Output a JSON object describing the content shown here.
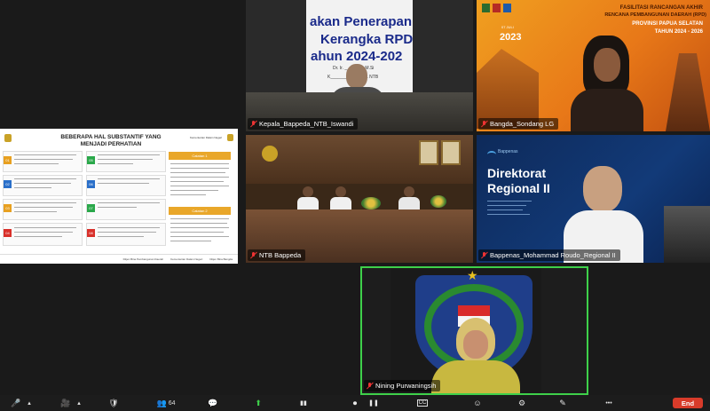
{
  "tiles": {
    "top_center": {
      "name": "Kepala_Bappeda_NTB_Iswandi",
      "slide_lines": [
        "akan Penerapan",
        "Kerangka RPD",
        "ahun 2024-202"
      ],
      "caption_lines": [
        "Dr. Ir. ___ANDI, M.Si",
        "K______________v. NTB"
      ]
    },
    "top_right": {
      "name": "Bangda_Sondang LG",
      "banner_line1": "FASILITASI RANCANGAN AKHIR",
      "banner_line2": "RENCANA PEMBANGUNAN DAERAH (RPD)",
      "banner_line3": "PROVINSI PAPUA SELATAN",
      "banner_line4": "TAHUN 2024 - 2026",
      "year": "2023",
      "date": "07 JULI"
    },
    "middle_center": {
      "name": "NTB Bappeda"
    },
    "middle_right": {
      "name": "Bappenas_Mohammad Roudo_Regional II",
      "title_line1": "Direktorat",
      "title_line2": "Regional II",
      "logo_text": "Bappenas"
    },
    "bottom_center": {
      "name": "Nining Purwaningsih"
    }
  },
  "slide": {
    "title_line1": "BEBERAPA HAL SUBSTANTIF YANG",
    "title_line2": "MENJADI PERHATIAN",
    "org": "Kementerian Dalam Negeri",
    "caption1": "Catatan 1",
    "caption2": "Catatan 2",
    "footer1": "Ditjen Bina Pembangunan Daerah",
    "footer2": "Kementerian Dalam Negeri",
    "footer3": "Ditjen Bina Bangda",
    "items": [
      "01",
      "02",
      "03",
      "04",
      "05",
      "06",
      "07",
      "08"
    ]
  },
  "toolbar": {
    "items": [
      {
        "glyph": "🎤",
        "name": "audio-icon"
      },
      {
        "glyph": "▴",
        "name": "audio-options-icon"
      },
      {
        "glyph": "🎥",
        "name": "video-icon"
      },
      {
        "glyph": "▴",
        "name": "video-options-icon"
      },
      {
        "glyph": "🛡",
        "name": "security-icon"
      },
      {
        "glyph": "👥",
        "name": "participants-icon",
        "count": "64"
      },
      {
        "glyph": "💬",
        "name": "chat-icon"
      },
      {
        "glyph": "⬆",
        "name": "share-screen-icon"
      },
      {
        "glyph": "▮▮",
        "name": "summary-icon"
      },
      {
        "glyph": "⏺",
        "name": "record-icon"
      },
      {
        "glyph": "CC",
        "name": "captions-icon"
      },
      {
        "glyph": "☺",
        "name": "reactions-icon"
      },
      {
        "glyph": "⚙",
        "name": "apps-icon"
      },
      {
        "glyph": "✎",
        "name": "whiteboard-icon"
      },
      {
        "glyph": "•••",
        "name": "more-icon"
      }
    ],
    "end_label": "End"
  }
}
